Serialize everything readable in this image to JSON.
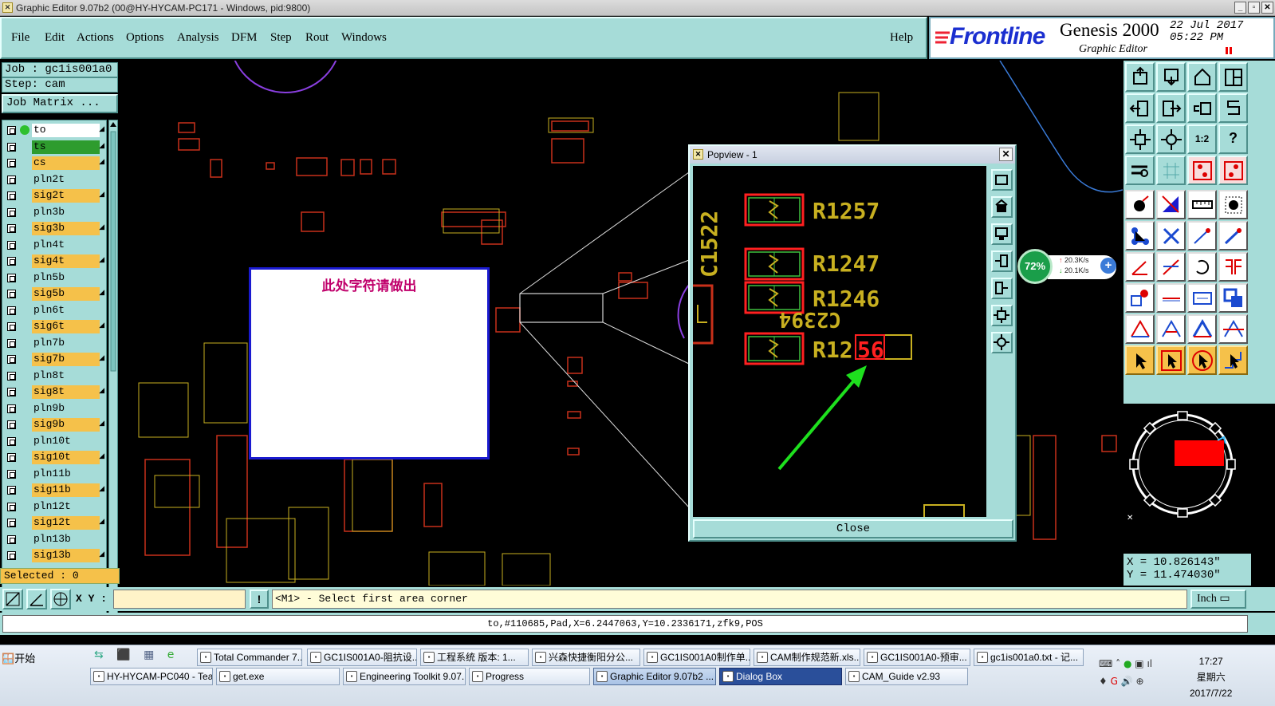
{
  "window": {
    "title": "Graphic Editor 9.07b2 (00@HY-HYCAM-PC171 - Windows, pid:9800)"
  },
  "menu": [
    "File",
    "Edit",
    "Actions",
    "Options",
    "Analysis",
    "DFM",
    "Step",
    "Rout",
    "Windows"
  ],
  "help": "Help",
  "brand": {
    "logo": "Frontline",
    "product": "Genesis 2000",
    "subtitle": "Graphic Editor",
    "date": "22 Jul 2017",
    "time": "05:22 PM"
  },
  "job": {
    "job_label": "Job : gc1is001a0",
    "step_label": "Step: cam",
    "matrix_button": "Job Matrix ..."
  },
  "layers": [
    {
      "name": "to",
      "color": "#ffffff",
      "dot": true
    },
    {
      "name": "ts",
      "color": "#2e9c2e"
    },
    {
      "name": "cs",
      "color": "#f5c14a"
    },
    {
      "name": "pln2t",
      "color": "#a6dcd8"
    },
    {
      "name": "sig2t",
      "color": "#f5c14a"
    },
    {
      "name": "pln3b",
      "color": "#a6dcd8"
    },
    {
      "name": "sig3b",
      "color": "#f5c14a"
    },
    {
      "name": "pln4t",
      "color": "#a6dcd8"
    },
    {
      "name": "sig4t",
      "color": "#f5c14a"
    },
    {
      "name": "pln5b",
      "color": "#a6dcd8"
    },
    {
      "name": "sig5b",
      "color": "#f5c14a"
    },
    {
      "name": "pln6t",
      "color": "#a6dcd8"
    },
    {
      "name": "sig6t",
      "color": "#f5c14a"
    },
    {
      "name": "pln7b",
      "color": "#a6dcd8"
    },
    {
      "name": "sig7b",
      "color": "#f5c14a"
    },
    {
      "name": "pln8t",
      "color": "#a6dcd8"
    },
    {
      "name": "sig8t",
      "color": "#f5c14a"
    },
    {
      "name": "pln9b",
      "color": "#a6dcd8"
    },
    {
      "name": "sig9b",
      "color": "#f5c14a"
    },
    {
      "name": "pln10t",
      "color": "#a6dcd8"
    },
    {
      "name": "sig10t",
      "color": "#f5c14a"
    },
    {
      "name": "pln11b",
      "color": "#a6dcd8"
    },
    {
      "name": "sig11b",
      "color": "#f5c14a"
    },
    {
      "name": "pln12t",
      "color": "#a6dcd8"
    },
    {
      "name": "sig12t",
      "color": "#f5c14a"
    },
    {
      "name": "pln13b",
      "color": "#a6dcd8"
    },
    {
      "name": "sig13b",
      "color": "#f5c14a"
    }
  ],
  "selected_label": "Selected : 0",
  "canvas": {
    "note_text": "此处字符请做出"
  },
  "popview": {
    "title": "Popview - 1",
    "labels": [
      "C1522",
      "R1257",
      "R1247",
      "R1246",
      "R12",
      "56",
      "C2394"
    ],
    "close_label": "Close"
  },
  "network": {
    "percent": "72%",
    "up": "20.3K/s",
    "down": "20.1K/s"
  },
  "coords": {
    "x": "X = 10.826143\"",
    "y": "Y = 11.474030\""
  },
  "status": {
    "xy_label": "X Y :",
    "xy_value": "",
    "prompt": "<M1> - Select first area corner",
    "unit": "Inch",
    "info": "to,#110685,Pad,X=6.2447063,Y=10.2336171,zfk9,POS"
  },
  "taskbar": {
    "start": "开始",
    "row1": [
      "Total Commander 7....",
      "GC1IS001A0-阻抗设...",
      "工程系统  版本: 1...",
      "兴森快捷衡阳分公...",
      "GC1IS001A0制作单...",
      "CAM制作规范新.xls...",
      "GC1IS001A0-预审...",
      "gc1is001a0.txt - 记..."
    ],
    "row2": [
      "HY-HYCAM-PC040 - Tea...",
      "get.exe",
      "Engineering Toolkit 9.07...",
      "Progress",
      "Graphic Editor 9.07b2 ...",
      "Dialog Box",
      "CAM_Guide v2.93"
    ],
    "clock_time": "17:27",
    "clock_day": "星期六",
    "clock_date": "2017/7/22"
  },
  "colors": {
    "panel": "#a6dcd8",
    "accent_orange": "#f5c14a",
    "pad_red": "#ff2020",
    "pad_green": "#3fbf3f",
    "trace_yellow": "#c8b020"
  }
}
